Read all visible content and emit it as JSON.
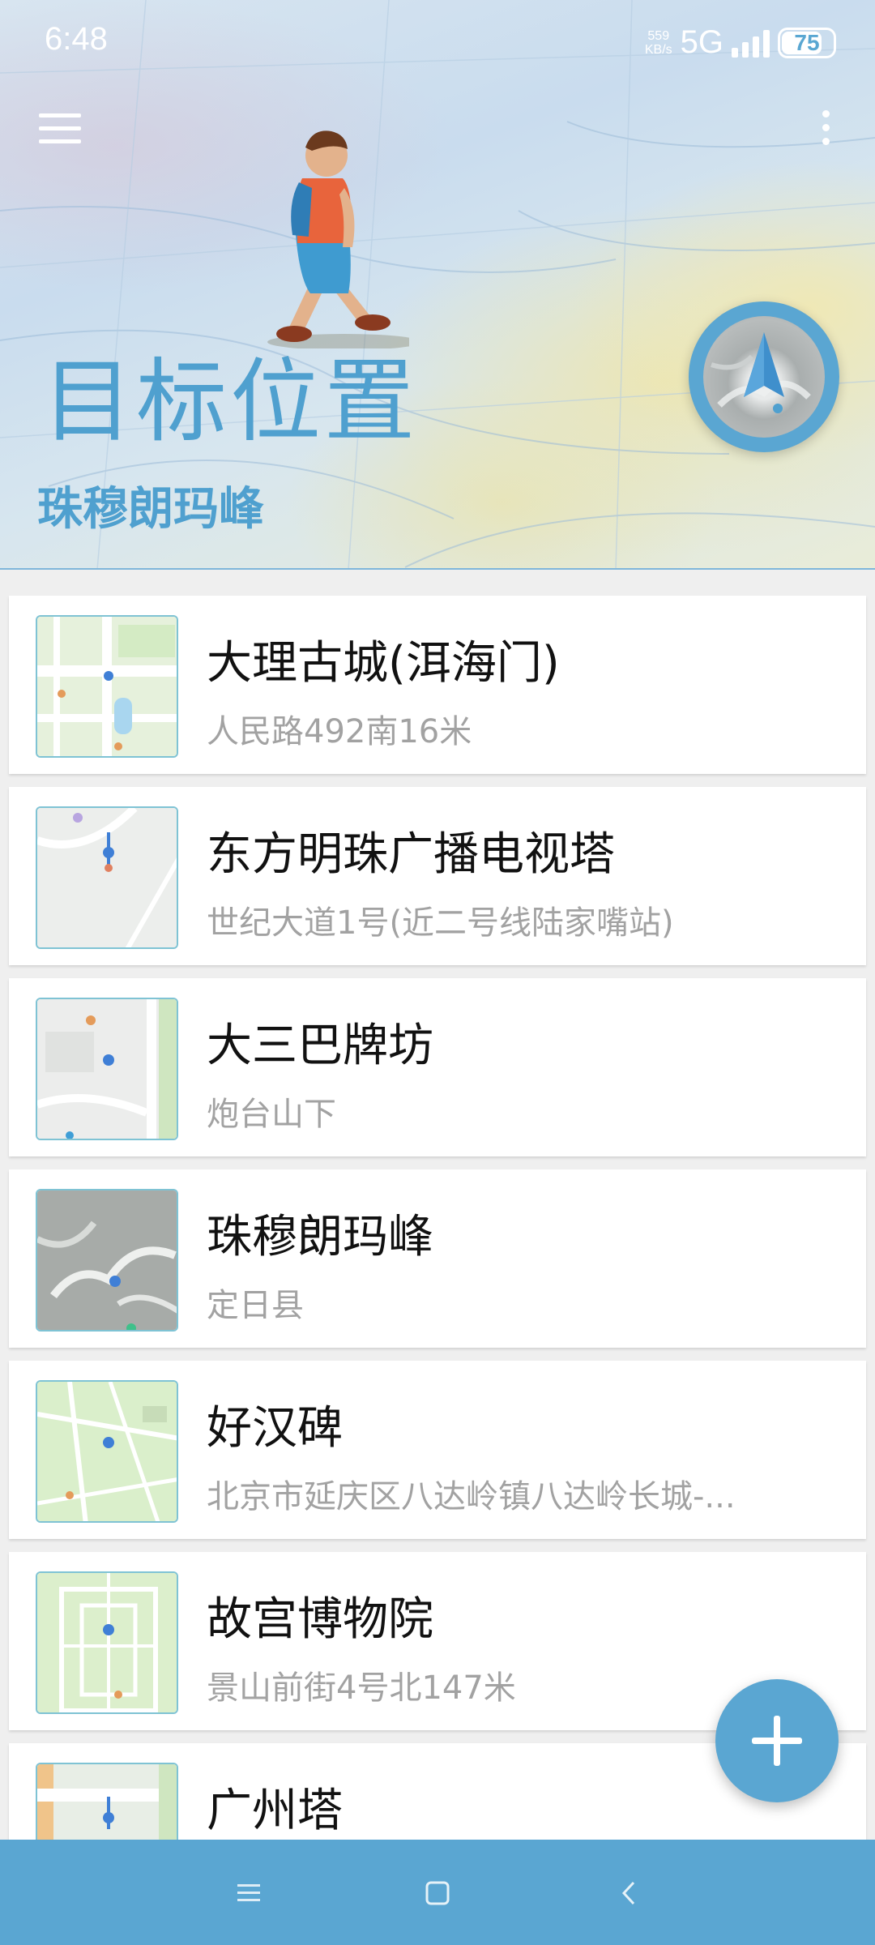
{
  "status_bar": {
    "time": "6:48",
    "net_speed_value": "559",
    "net_speed_unit": "KB/s",
    "network_type": "5G",
    "battery_level": "75"
  },
  "header": {
    "title": "目标位置",
    "current_target": "珠穆朗玛峰",
    "menu_icon": "hamburger-menu-icon",
    "more_icon": "more-vertical-icon",
    "compass_icon": "navigation-compass-icon"
  },
  "locations": [
    {
      "name": "大理古城(洱海门)",
      "address": "人民路492南16米"
    },
    {
      "name": "东方明珠广播电视塔",
      "address": "世纪大道1号(近二号线陆家嘴站)"
    },
    {
      "name": "大三巴牌坊",
      "address": "炮台山下"
    },
    {
      "name": "珠穆朗玛峰",
      "address": "定日县"
    },
    {
      "name": "好汉碑",
      "address": "北京市延庆区八达岭镇八达岭长城-..."
    },
    {
      "name": "故宫博物院",
      "address": "景山前街4号北147米"
    },
    {
      "name": "广州塔",
      "address": ""
    }
  ],
  "fab": {
    "icon": "plus-icon"
  },
  "nav_bar": {
    "menu_icon": "recent-apps-icon",
    "home_icon": "home-icon",
    "back_icon": "back-icon"
  },
  "colors": {
    "accent": "#5aa6d2",
    "title_blue": "#4fa0cf",
    "card_bg": "#ffffff",
    "address_gray": "#a2a2a2"
  }
}
